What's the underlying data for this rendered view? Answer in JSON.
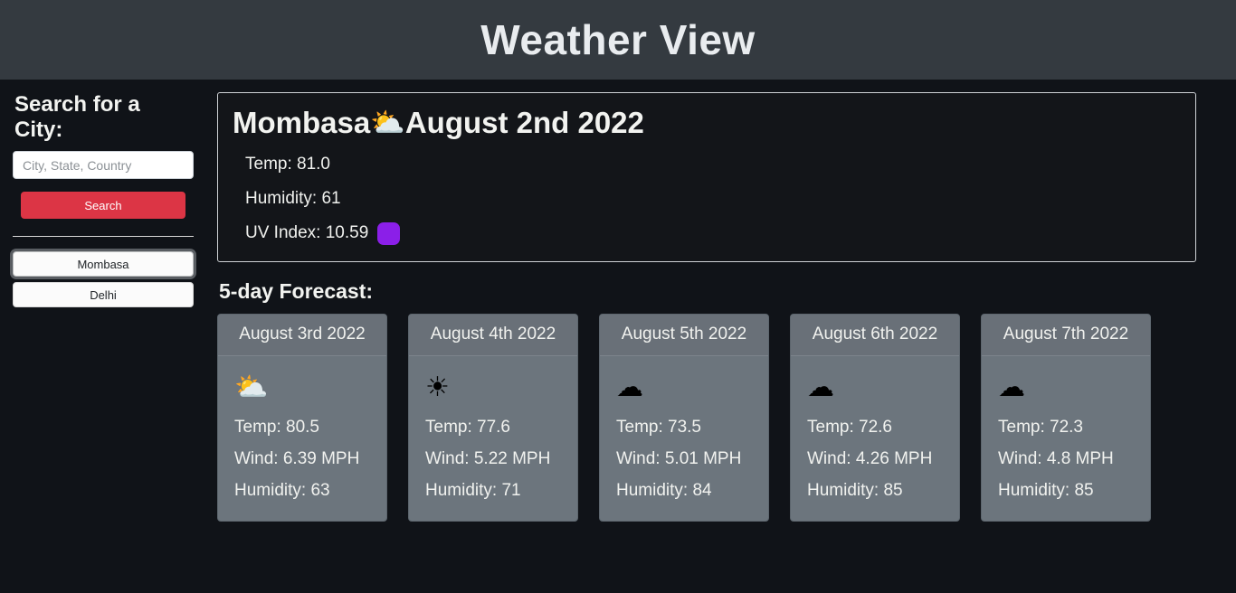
{
  "header": {
    "title": "Weather View",
    "background_color": "#343a40",
    "text_color": "#e9ecef"
  },
  "sidebar": {
    "title": "Search for a City:",
    "search_input": {
      "placeholder": "City, State, Country",
      "value": ""
    },
    "search_button": {
      "label": "Search",
      "color": "#dc3545"
    },
    "city_history": [
      {
        "label": "Mombasa",
        "active": true
      },
      {
        "label": "Delhi",
        "active": false
      }
    ]
  },
  "current": {
    "city": "Mombasa",
    "icon": "sun-behind-cloud-icon",
    "icon_glyph": "⛅",
    "date": "August 2nd 2022",
    "temp_label": "Temp: 81.0",
    "humidity_label": "Humidity: 61",
    "uv_label": "UV Index: 10.59",
    "uv_value": "10.59",
    "uv_badge_color": "#8b1fe8"
  },
  "forecast": {
    "title": "5-day Forecast:",
    "days": [
      {
        "date": "August 3rd 2022",
        "icon": "sun-behind-cloud-icon",
        "icon_glyph": "⛅",
        "temp_label": "Temp: 80.5",
        "wind_label": "Wind: 6.39 MPH",
        "humidity_label": "Humidity: 63"
      },
      {
        "date": "August 4th 2022",
        "icon": "sun-icon",
        "icon_glyph": "☀",
        "temp_label": "Temp: 77.6",
        "wind_label": "Wind: 5.22 MPH",
        "humidity_label": "Humidity: 71"
      },
      {
        "date": "August 5th 2022",
        "icon": "cloud-icon",
        "icon_glyph": "☁",
        "temp_label": "Temp: 73.5",
        "wind_label": "Wind: 5.01 MPH",
        "humidity_label": "Humidity: 84"
      },
      {
        "date": "August 6th 2022",
        "icon": "cloud-icon",
        "icon_glyph": "☁",
        "temp_label": "Temp: 72.6",
        "wind_label": "Wind: 4.26 MPH",
        "humidity_label": "Humidity: 85"
      },
      {
        "date": "August 7th 2022",
        "icon": "cloud-icon",
        "icon_glyph": "☁",
        "temp_label": "Temp: 72.3",
        "wind_label": "Wind: 4.8 MPH",
        "humidity_label": "Humidity: 85"
      }
    ]
  }
}
